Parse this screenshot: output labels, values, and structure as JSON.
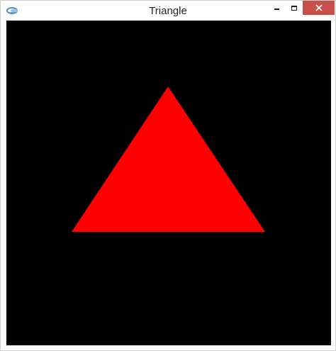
{
  "window": {
    "title": "Triangle",
    "icons": {
      "app": "app-icon",
      "minimize": "minimize-icon",
      "maximize": "maximize-icon",
      "close": "close-icon"
    }
  },
  "colors": {
    "canvas_background": "#000000",
    "triangle_fill": "#ff0000",
    "close_button": "#c7504b"
  }
}
